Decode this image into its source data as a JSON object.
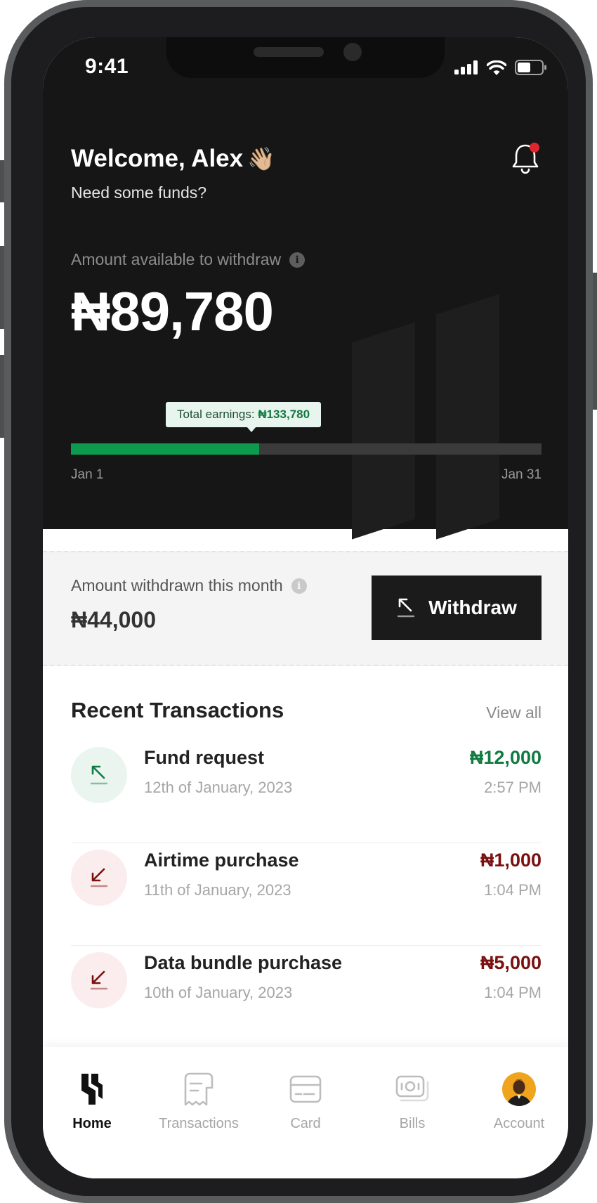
{
  "status_bar": {
    "time": "9:41"
  },
  "header": {
    "welcome": "Welcome, Alex",
    "wave_emoji": "👋🏼",
    "subtitle": "Need some funds?"
  },
  "balance": {
    "label": "Amount available to withdraw",
    "info_glyph": "i",
    "amount": "₦89,780"
  },
  "earnings": {
    "label": "Total earnings:",
    "amount": "₦133,780",
    "progress_fraction": 0.4,
    "start_date": "Jan 1",
    "end_date": "Jan 31"
  },
  "withdrawn": {
    "label": "Amount withdrawn this month",
    "info_glyph": "i",
    "amount": "₦44,000",
    "button_label": "Withdraw"
  },
  "transactions": {
    "title": "Recent Transactions",
    "view_all": "View all",
    "items": [
      {
        "title": "Fund request",
        "date": "12th of January, 2023",
        "amount": "₦12,000",
        "time": "2:57 PM",
        "direction": "in",
        "icon": "arrow-up-left-icon"
      },
      {
        "title": "Airtime purchase",
        "date": "11th of January, 2023",
        "amount": "₦1,000",
        "time": "1:04 PM",
        "direction": "out",
        "icon": "arrow-down-left-icon"
      },
      {
        "title": "Data bundle purchase",
        "date": "10th of January, 2023",
        "amount": "₦5,000",
        "time": "1:04 PM",
        "direction": "out",
        "icon": "arrow-down-left-icon"
      }
    ]
  },
  "tabs": [
    {
      "label": "Home",
      "icon": "home-logo-icon",
      "active": true
    },
    {
      "label": "Transactions",
      "icon": "receipt-icon",
      "active": false
    },
    {
      "label": "Card",
      "icon": "card-icon",
      "active": false
    },
    {
      "label": "Bills",
      "icon": "bills-icon",
      "active": false
    },
    {
      "label": "Account",
      "icon": "avatar",
      "active": false
    }
  ],
  "colors": {
    "hero_background": "#161616",
    "accent_green": "#0e9a4e",
    "income_green": "#127a42",
    "expense_red": "#7a1010",
    "notification_red": "#e0262b"
  }
}
